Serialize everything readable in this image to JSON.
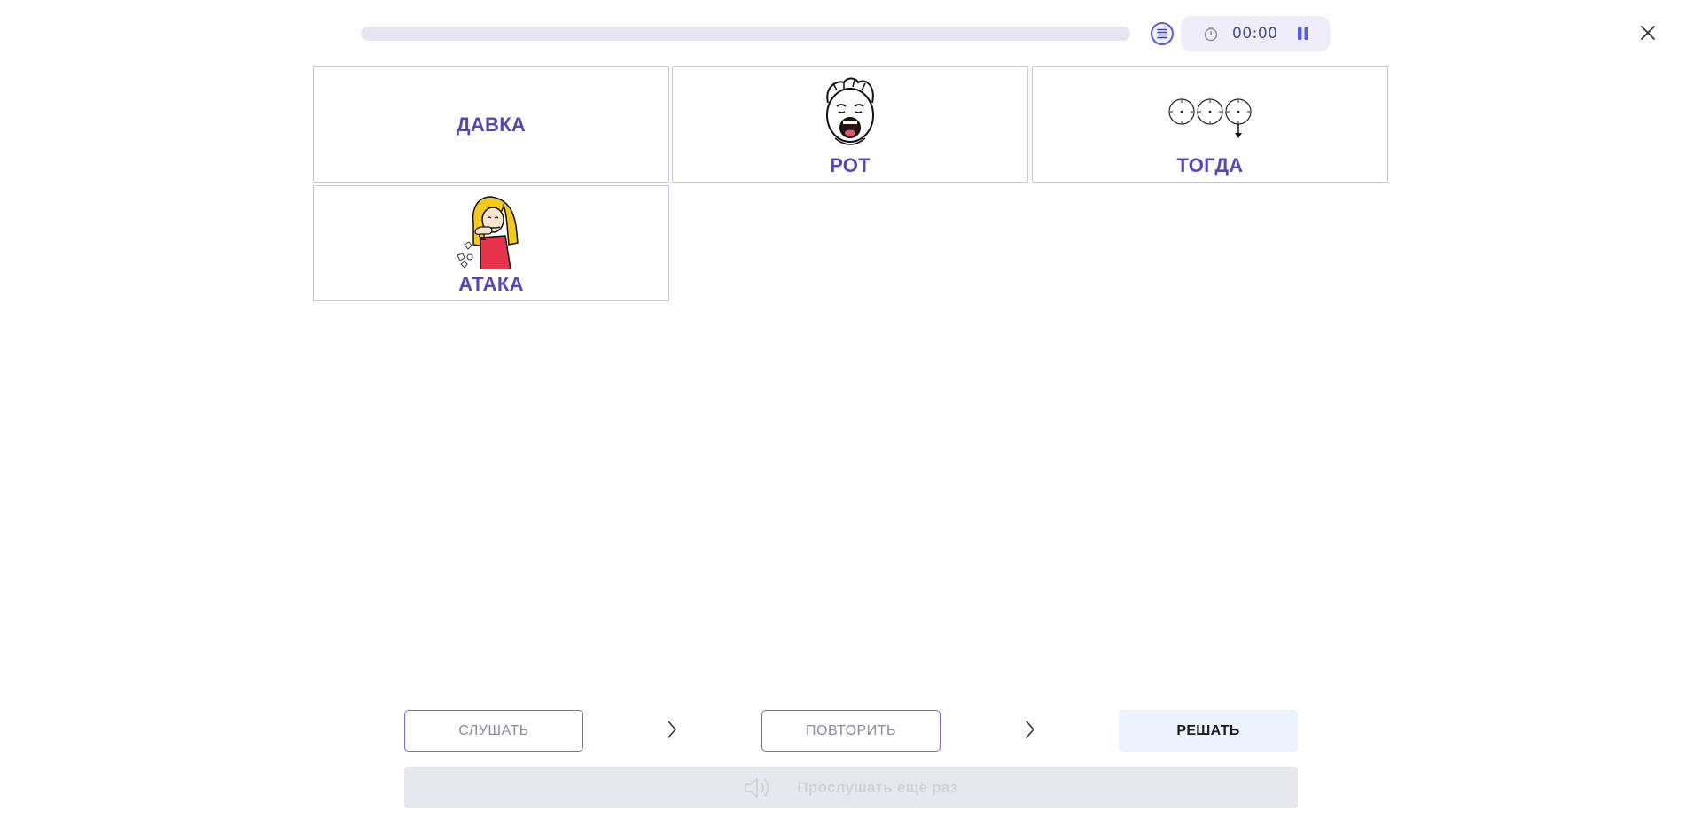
{
  "timer": {
    "time": "00:00"
  },
  "progress": {
    "value": 0
  },
  "cards": [
    {
      "label": "ДАВКА",
      "image": "none"
    },
    {
      "label": "РОТ",
      "image": "boy-open-mouth"
    },
    {
      "label": "ТОГДА",
      "image": "clocks-sequence"
    },
    {
      "label": "АТАКА",
      "image": "girl-coughing"
    }
  ],
  "controls": {
    "listen_label": "СЛУШАТЬ",
    "repeat_label": "ПОВТОРИТЬ",
    "solve_label": "РЕШАТЬ",
    "replay_label": "Прослушать ещё раз"
  },
  "colors": {
    "accent": "#5a45b8",
    "outline": "#7b68d8",
    "progress_track": "#e7e5f2",
    "solve_bg": "#edf3fd",
    "replay_bg": "#e6e8ee"
  }
}
